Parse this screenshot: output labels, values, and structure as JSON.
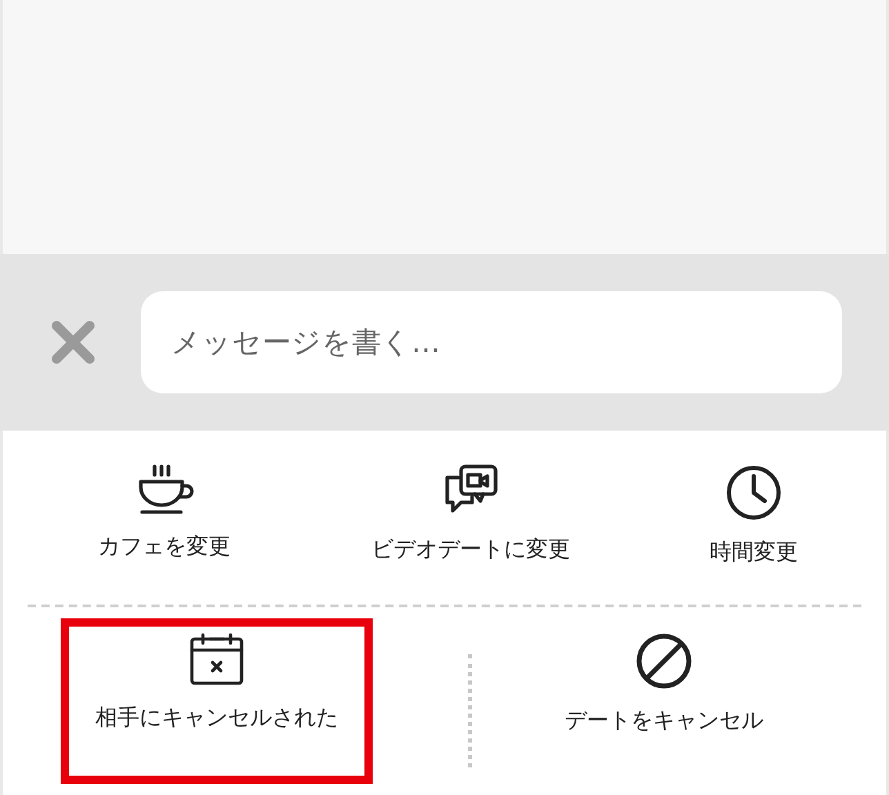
{
  "composer": {
    "placeholder": "メッセージを書く…"
  },
  "actions_top": [
    {
      "kind": "cafe",
      "label": "カフェを変更"
    },
    {
      "kind": "video",
      "label": "ビデオデートに変更"
    },
    {
      "kind": "time",
      "label": "時間変更"
    }
  ],
  "actions_bottom": [
    {
      "kind": "cancelled",
      "label": "相手にキャンセルされた",
      "highlighted": true
    },
    {
      "kind": "cancel",
      "label": "デートをキャンセル",
      "highlighted": false
    }
  ]
}
